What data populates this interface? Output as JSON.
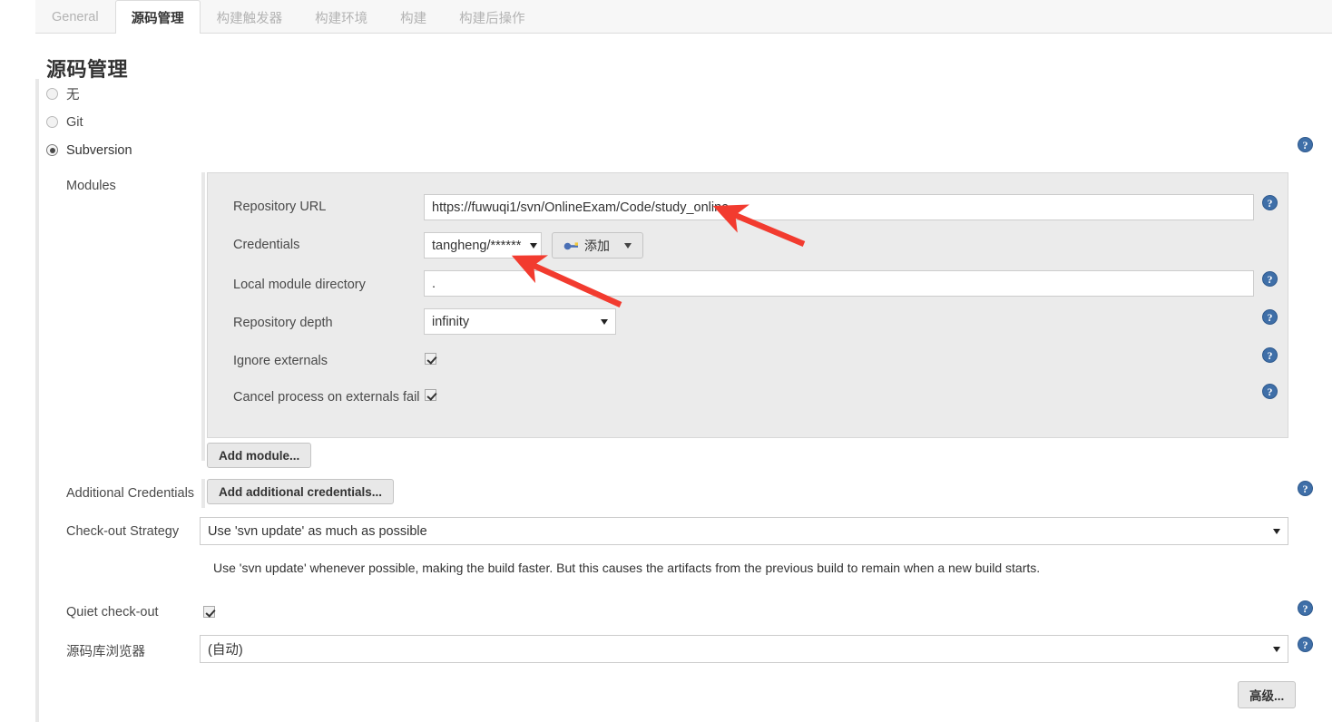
{
  "tabs": [
    {
      "label": "General",
      "active": false
    },
    {
      "label": "源码管理",
      "active": true
    },
    {
      "label": "构建触发器",
      "active": false
    },
    {
      "label": "构建环境",
      "active": false
    },
    {
      "label": "构建",
      "active": false
    },
    {
      "label": "构建后操作",
      "active": false
    }
  ],
  "page": {
    "title": "源码管理"
  },
  "scm_options": [
    {
      "label": "无",
      "selected": false
    },
    {
      "label": "Git",
      "selected": false
    },
    {
      "label": "Subversion",
      "selected": true
    }
  ],
  "modules": {
    "section_label": "Modules",
    "repository_url": {
      "label": "Repository URL",
      "value": "https://fuwuqi1/svn/OnlineExam/Code/study_online"
    },
    "credentials": {
      "label": "Credentials",
      "value": "tangheng/******",
      "add_button": "添加"
    },
    "local_module_directory": {
      "label": "Local module directory",
      "value": "."
    },
    "repository_depth": {
      "label": "Repository depth",
      "value": "infinity"
    },
    "ignore_externals": {
      "label": "Ignore externals",
      "checked": true
    },
    "cancel_process_on_externals_fail": {
      "label": "Cancel process on externals fail",
      "checked": true
    },
    "add_module_button": "Add module..."
  },
  "additional_credentials": {
    "label": "Additional Credentials",
    "button": "Add additional credentials..."
  },
  "checkout_strategy": {
    "label": "Check-out Strategy",
    "value": "Use 'svn update' as much as possible",
    "description": "Use 'svn update' whenever possible, making the build faster. But this causes the artifacts from the previous build to remain when a new build starts."
  },
  "quiet_checkout": {
    "label": "Quiet check-out",
    "checked": true
  },
  "repository_browser": {
    "label": "源码库浏览器",
    "value": "(自动)"
  },
  "advanced_button": "高级...",
  "help_icon_glyph": "?",
  "colors": {
    "accent_blue": "#3f6fa8",
    "annotation_red": "#f23b2f",
    "panel_gray": "#ebebeb",
    "tab_inactive": "#b3b3b3"
  }
}
